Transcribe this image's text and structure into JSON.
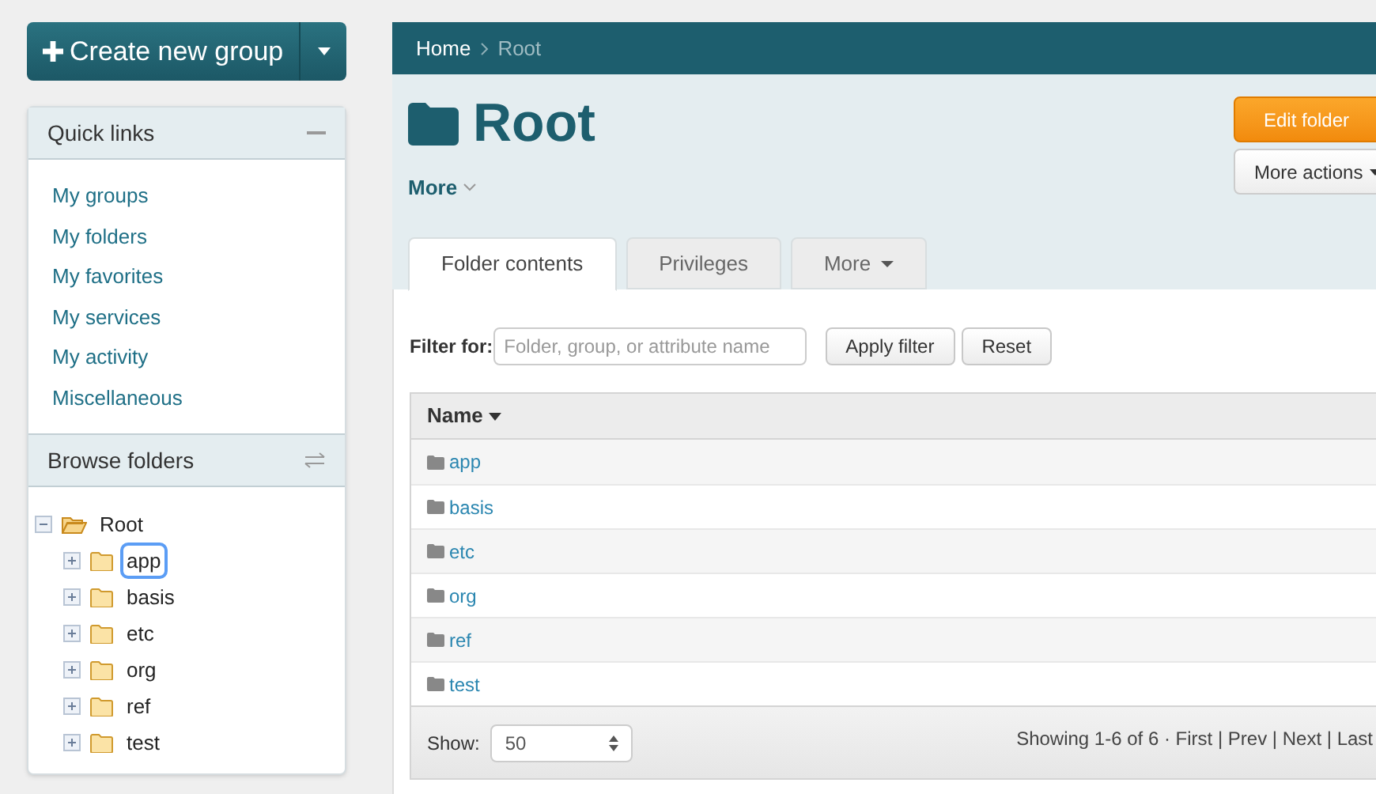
{
  "create_button": {
    "label": "Create new group"
  },
  "quick_links": {
    "title": "Quick links",
    "items": [
      {
        "label": "My groups"
      },
      {
        "label": "My folders"
      },
      {
        "label": "My favorites"
      },
      {
        "label": "My services"
      },
      {
        "label": "My activity"
      },
      {
        "label": "Miscellaneous"
      }
    ]
  },
  "browse_folders": {
    "title": "Browse folders",
    "tree": [
      {
        "label": "Root",
        "expanded": true,
        "selected": false,
        "children": [
          {
            "label": "app",
            "expanded": false,
            "selected": true
          },
          {
            "label": "basis",
            "expanded": false,
            "selected": false
          },
          {
            "label": "etc",
            "expanded": false,
            "selected": false
          },
          {
            "label": "org",
            "expanded": false,
            "selected": false
          },
          {
            "label": "ref",
            "expanded": false,
            "selected": false
          },
          {
            "label": "test",
            "expanded": false,
            "selected": false
          }
        ]
      }
    ]
  },
  "breadcrumb": [
    {
      "label": "Home"
    },
    {
      "label": "Root"
    }
  ],
  "folder": {
    "title": "Root",
    "more": "More"
  },
  "actions": [
    {
      "label": "Edit folder",
      "kind": "primary"
    },
    {
      "label": "More actions",
      "kind": "dropdown"
    }
  ],
  "tabs": [
    {
      "label": "Folder contents",
      "selected": true,
      "dropdown": false
    },
    {
      "label": "Privileges",
      "selected": false,
      "dropdown": false
    },
    {
      "label": "More",
      "selected": false,
      "dropdown": true
    }
  ],
  "filter": {
    "label": "Filter for:",
    "placeholder": "Folder, group, or attribute name",
    "buttons": [
      "Apply filter",
      "Reset"
    ]
  },
  "table": {
    "columns": [
      "Name"
    ],
    "rows": [
      {
        "name": "app"
      },
      {
        "name": "basis"
      },
      {
        "name": "etc"
      },
      {
        "name": "org"
      },
      {
        "name": "ref"
      },
      {
        "name": "test"
      }
    ]
  },
  "footer": {
    "show_label": "Show:",
    "page_size": "50",
    "paging": "Showing 1-6 of 6 · First | Prev | Next | Last"
  }
}
